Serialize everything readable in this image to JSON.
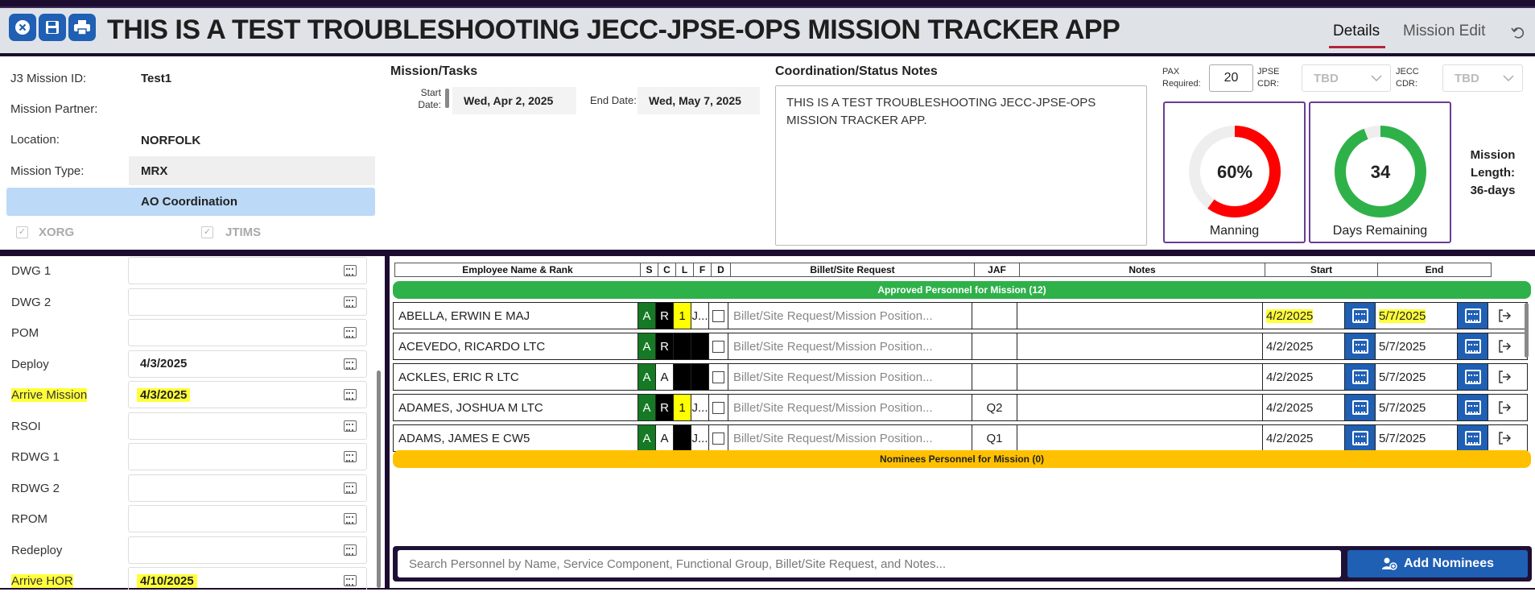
{
  "header": {
    "title": "THIS IS A TEST TROUBLESHOOTING JECC-JPSE-OPS MISSION TRACKER APP",
    "tabs": [
      {
        "label": "Details"
      },
      {
        "label": "Mission Edit"
      }
    ]
  },
  "details": {
    "fields": [
      {
        "label": "J3 Mission ID:",
        "value": "Test1"
      },
      {
        "label": "Mission Partner:",
        "value": ""
      },
      {
        "label": "Location:",
        "value": "NORFOLK"
      },
      {
        "label": "Mission Type:",
        "value": "MRX"
      },
      {
        "label": "",
        "value": "AO Coordination"
      }
    ],
    "checkboxes": [
      {
        "label": "XORG",
        "checked": true
      },
      {
        "label": "JTIMS",
        "checked": true
      }
    ],
    "tasks_heading": "Mission/Tasks",
    "start_label_1": "Start",
    "start_label_2": "Date:",
    "start_date": "Wed, Apr 2, 2025",
    "end_label": "End Date:",
    "end_date": "Wed, May 7, 2025",
    "notes_heading": "Coordination/Status Notes",
    "notes_text": "THIS IS A TEST TROUBLESHOOTING JECC-JPSE-OPS MISSION TRACKER APP.",
    "pax_label_1": "PAX",
    "pax_label_2": "Required:",
    "pax_value": "20",
    "jpse_label_1": "JPSE",
    "jpse_label_2": "CDR:",
    "jpse_value": "TBD",
    "jecc_label_1": "JECC",
    "jecc_label_2": "CDR:",
    "jecc_value": "TBD",
    "manning": {
      "value": "60%",
      "fraction": 0.6,
      "label": "Manning",
      "color": "#ff0000"
    },
    "days": {
      "value": "34",
      "fraction": 0.94,
      "label": "Days Remaining",
      "color": "#2fb14a"
    },
    "mission_length_1": "Mission",
    "mission_length_2": "Length:",
    "mission_length_3": "36-days"
  },
  "milestones": [
    {
      "label": "DWG 1",
      "value": "",
      "highlight": false
    },
    {
      "label": "DWG 2",
      "value": "",
      "highlight": false
    },
    {
      "label": "POM",
      "value": "",
      "highlight": false
    },
    {
      "label": "Deploy",
      "value": "4/3/2025",
      "highlight": false
    },
    {
      "label": "Arrive Mission",
      "value": "4/3/2025",
      "highlight": true
    },
    {
      "label": "RSOI",
      "value": "",
      "highlight": false
    },
    {
      "label": "RDWG 1",
      "value": "",
      "highlight": false
    },
    {
      "label": "RDWG 2",
      "value": "",
      "highlight": false
    },
    {
      "label": "RPOM",
      "value": "",
      "highlight": false
    },
    {
      "label": "Redeploy",
      "value": "",
      "highlight": false
    },
    {
      "label": "Arrive HOR",
      "value": "4/10/2025",
      "highlight": true
    }
  ],
  "table": {
    "headers": [
      "Employee Name & Rank",
      "S",
      "C",
      "L",
      "F",
      "D",
      "Billet/Site Request",
      "JAF",
      "Notes",
      "Start",
      "End"
    ],
    "approved_band": "Approved Personnel for Mission (12)",
    "nominees_band": "Nominees Personnel for Mission (0)",
    "billet_placeholder": "Billet/Site Request/Mission Position...",
    "rows": [
      {
        "name": "ABELLA, ERWIN E MAJ",
        "s": "A",
        "c": "R",
        "l": "1",
        "f": "J...",
        "jaf": "",
        "start": "4/2/2025",
        "end": "5/7/2025",
        "hl": true
      },
      {
        "name": "ACEVEDO, RICARDO LTC",
        "s": "A",
        "c": "R",
        "l": "",
        "f": "",
        "jaf": "",
        "start": "4/2/2025",
        "end": "5/7/2025",
        "hl": false
      },
      {
        "name": "ACKLES, ERIC R LTC",
        "s": "A",
        "c": "A",
        "l": "",
        "f": "",
        "jaf": "",
        "start": "4/2/2025",
        "end": "5/7/2025",
        "hl": false
      },
      {
        "name": "ADAMES, JOSHUA M LTC",
        "s": "A",
        "c": "R",
        "l": "1",
        "f": "J...",
        "jaf": "Q2",
        "start": "4/2/2025",
        "end": "5/7/2025",
        "hl": false
      },
      {
        "name": "ADAMS, JAMES E CW5",
        "s": "A",
        "c": "A",
        "l": "",
        "f": "J...",
        "jaf": "Q1",
        "start": "4/2/2025",
        "end": "5/7/2025",
        "hl": false
      }
    ]
  },
  "search": {
    "placeholder": "Search Personnel by Name, Service Component, Functional Group, Billet/Site Request, and Notes..."
  },
  "add_button": "Add Nominees"
}
